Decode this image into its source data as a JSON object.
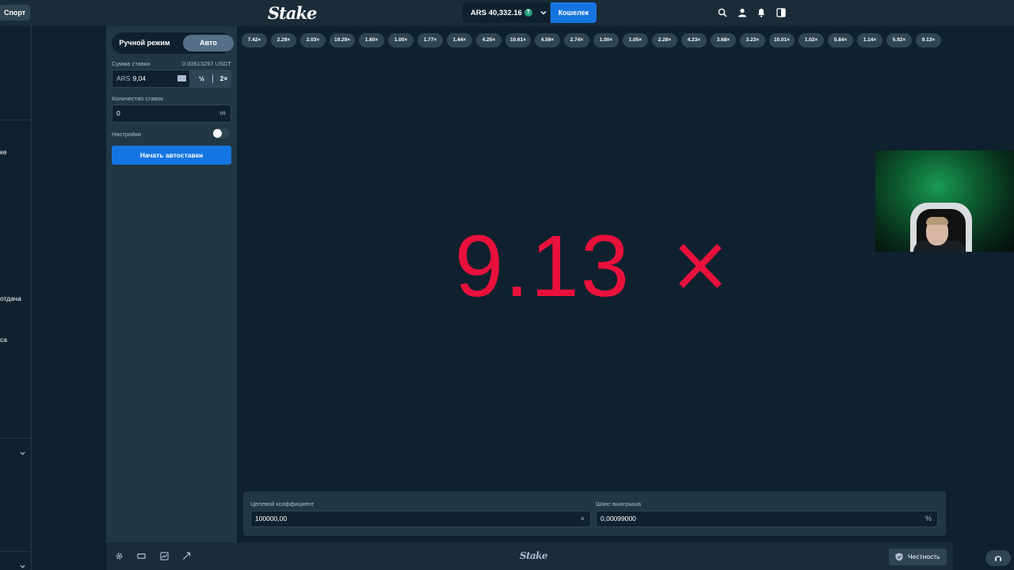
{
  "topbar": {
    "sport_label": "Спорт",
    "logo_text": "Stake",
    "balance": "ARS 40,332.16",
    "coin_symbol": "T",
    "wallet_label": "Кошелек"
  },
  "leftnav": {
    "clipped_items": [
      "ке",
      "отдача",
      "са"
    ]
  },
  "panel": {
    "manual_label": "Ручной режим",
    "auto_label": "Авто",
    "bet_amount_label": "Сумма ставки",
    "bet_amount_converted": "0.00613297 USDT",
    "bet_currency": "ARS",
    "bet_value": "9,04",
    "half_label": "½",
    "double_label": "2×",
    "bet_count_label": "Количество ставок",
    "bet_count_value": "0",
    "infinity_symbol": "∞",
    "settings_label": "Настройки",
    "start_label": "Начать автоставки"
  },
  "game": {
    "history": [
      "7.42×",
      "2.29×",
      "2.03×",
      "19.29×",
      "1.60×",
      "1.00×",
      "1.77×",
      "1.44×",
      "4.25×",
      "10.61×",
      "4.59×",
      "2.74×",
      "1.00×",
      "1.05×",
      "2.28×",
      "4.23×",
      "3.68×",
      "3.23×",
      "10.01×",
      "1.02×",
      "5.84×",
      "1.14×",
      "5.92×",
      "9.13×"
    ],
    "result_multiplier": "9.13",
    "result_color": "#e9113c",
    "target_label": "Целевой коэффициент",
    "target_value": "100000,00",
    "target_suffix": "×",
    "chance_label": "Шанс выигрыша",
    "chance_value": "0,00099000",
    "chance_suffix": "%"
  },
  "bottombar": {
    "logo_text": "Stake",
    "fairness_label": "Честность"
  },
  "colors": {
    "accent_blue": "#1475e1",
    "background": "#0f212e",
    "panel": "#213743",
    "chip": "#2f4553"
  }
}
